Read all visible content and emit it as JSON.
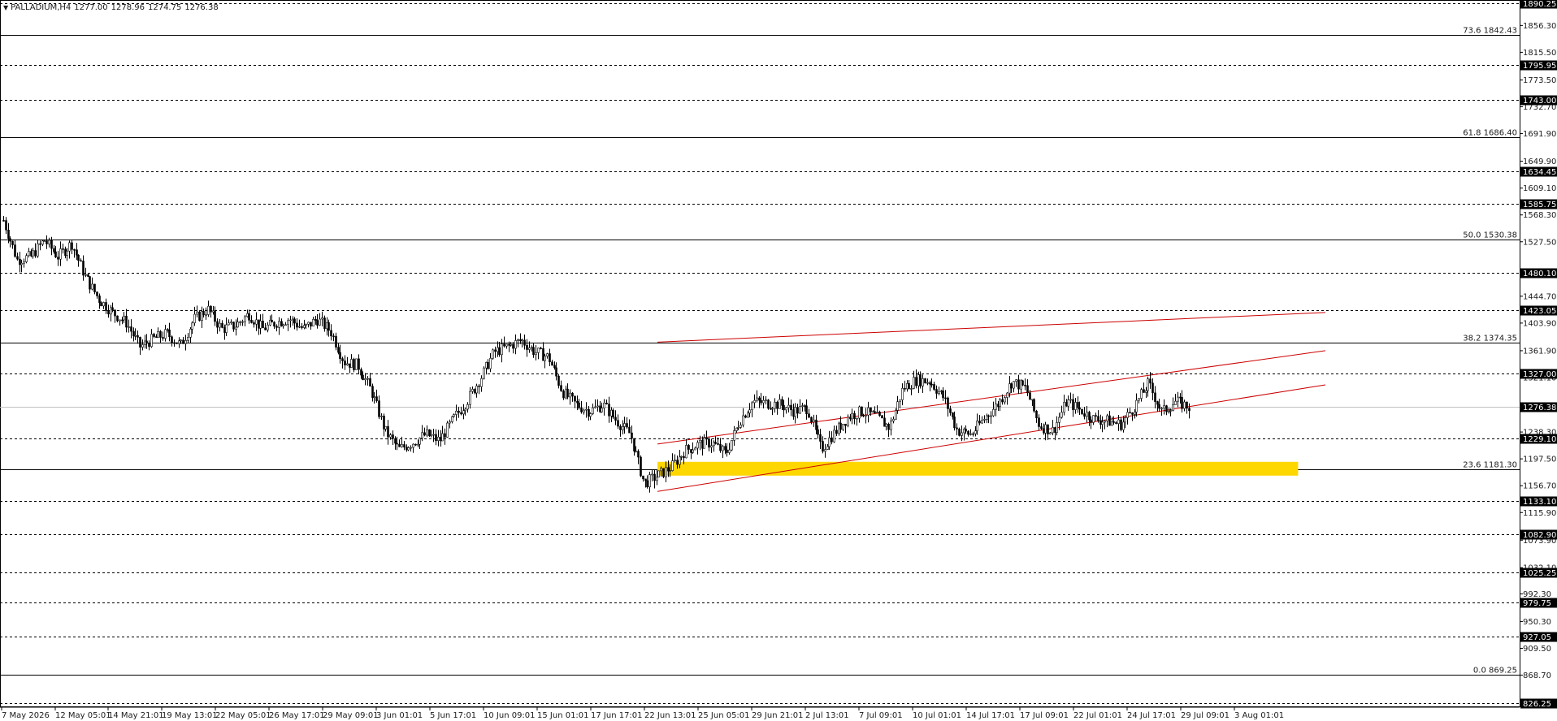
{
  "header": {
    "symbol": "PALLADIUM,H4",
    "open": "1277.00",
    "high": "1278.96",
    "low": "1274.75",
    "close": "1276.38"
  },
  "chart_data": {
    "type": "candlestick",
    "title": "PALLADIUM,H4",
    "y_range": [
      820,
      1895
    ],
    "price_ticks": [
      "1856.30",
      "1815.50",
      "1773.50",
      "1732.70",
      "1691.90",
      "1649.90",
      "1609.10",
      "1568.30",
      "1527.50",
      "1444.70",
      "1403.90",
      "1361.90",
      "1321.10",
      "1238.30",
      "1197.50",
      "1156.70",
      "1115.90",
      "1073.90",
      "1032.10",
      "992.30",
      "950.30",
      "909.50",
      "868.70"
    ],
    "horizontal_levels": [
      {
        "price": 1890.25,
        "style": "dashed",
        "boxed": true,
        "label": "1890.25"
      },
      {
        "price": 1795.95,
        "style": "dashed",
        "boxed": true,
        "label": "1795.95"
      },
      {
        "price": 1743.0,
        "style": "dashed",
        "boxed": true,
        "label": "1743.00"
      },
      {
        "price": 1634.45,
        "style": "dashed",
        "boxed": true,
        "label": "1634.45"
      },
      {
        "price": 1585.75,
        "style": "dashed",
        "boxed": true,
        "label": "1585.75"
      },
      {
        "price": 1480.1,
        "style": "dashed",
        "boxed": true,
        "label": "1480.10"
      },
      {
        "price": 1423.05,
        "style": "dashed",
        "boxed": true,
        "label": "1423.05"
      },
      {
        "price": 1327.0,
        "style": "dashed",
        "boxed": true,
        "label": "1327.00"
      },
      {
        "price": 1229.1,
        "style": "dashed",
        "boxed": true,
        "label": "1229.10"
      },
      {
        "price": 1133.1,
        "style": "dashed",
        "boxed": true,
        "label": "1133.10"
      },
      {
        "price": 1082.9,
        "style": "dashed",
        "boxed": true,
        "label": "1082.90"
      },
      {
        "price": 1025.25,
        "style": "dashed",
        "boxed": true,
        "label": "1025.25"
      },
      {
        "price": 979.75,
        "style": "dashed",
        "boxed": true,
        "label": "979.75"
      },
      {
        "price": 927.05,
        "style": "dashed",
        "boxed": true,
        "label": "927.05"
      },
      {
        "price": 826.25,
        "style": "dashed",
        "boxed": true,
        "label": "826.25"
      }
    ],
    "current_price": {
      "price": 1276.38,
      "label": "1276.38"
    },
    "fibonacci": [
      {
        "price": 1842.43,
        "label": "73.6 1842.43"
      },
      {
        "price": 1686.4,
        "label": "61.8 1686.40"
      },
      {
        "price": 1530.38,
        "label": "50.0 1530.38"
      },
      {
        "price": 1374.35,
        "label": "38.2 1374.35"
      },
      {
        "price": 1181.3,
        "label": "23.6 1181.30"
      },
      {
        "price": 869.25,
        "label": "0.0 869.25"
      }
    ],
    "support_zone": {
      "price_low": 1172,
      "price_high": 1193,
      "start_date": "24 Jun 2026",
      "end_date": "10 Aug 2026",
      "color": "#ffd700"
    },
    "channel_lines": [
      {
        "start_date": "24 Jun 2026",
        "start_price": 1375,
        "end_date": "12 Aug 2026",
        "end_price": 1420
      },
      {
        "start_date": "24 Jun 2026",
        "start_price": 1220,
        "end_date": "12 Aug 2026",
        "end_price": 1362
      },
      {
        "start_date": "24 Jun 2026",
        "start_price": 1148,
        "end_date": "12 Aug 2026",
        "end_price": 1310
      }
    ],
    "time_labels": [
      "7 May 2026",
      "12 May 05:01",
      "14 May 21:01",
      "19 May 13:01",
      "22 May 05:01",
      "26 May 17:01",
      "29 May 09:01",
      "3 Jun 01:01",
      "5 Jun 17:01",
      "10 Jun 09:01",
      "15 Jun 01:01",
      "17 Jun 17:01",
      "22 Jun 13:01",
      "25 Jun 05:01",
      "29 Jun 21:01",
      "2 Jul 13:01",
      "7 Jul 09:01",
      "10 Jul 01:01",
      "14 Jul 17:01",
      "17 Jul 09:01",
      "22 Jul 01:01",
      "24 Jul 17:01",
      "29 Jul 09:01",
      "3 Aug 01:01"
    ],
    "price_path": [
      [
        "7 May 2026",
        1560
      ],
      [
        "8 May 2026",
        1500
      ],
      [
        "9 May 2026",
        1505
      ],
      [
        "10 May 2026",
        1530
      ],
      [
        "11 May 2026",
        1505
      ],
      [
        "12 May 2026",
        1525
      ],
      [
        "13 May 2026",
        1475
      ],
      [
        "14 May 2026",
        1440
      ],
      [
        "15 May 2026",
        1420
      ],
      [
        "16 May 2026",
        1405
      ],
      [
        "17 May 2026",
        1368
      ],
      [
        "18 May 2026",
        1380
      ],
      [
        "19 May 2026",
        1388
      ],
      [
        "20 May 2026",
        1370
      ],
      [
        "21 May 2026",
        1410
      ],
      [
        "22 May 2026",
        1425
      ],
      [
        "23 May 2026",
        1395
      ],
      [
        "24 May 2026",
        1400
      ],
      [
        "25 May 2026",
        1418
      ],
      [
        "26 May 2026",
        1395
      ],
      [
        "27 May 2026",
        1405
      ],
      [
        "28 May 2026",
        1410
      ],
      [
        "29 May 2026",
        1395
      ],
      [
        "30 May 2026",
        1410
      ],
      [
        "31 May 2026",
        1392
      ],
      [
        "1 Jun 2026",
        1345
      ],
      [
        "2 Jun 2026",
        1340
      ],
      [
        "3 Jun 2026",
        1300
      ],
      [
        "4 Jun 2026",
        1240
      ],
      [
        "5 Jun 2026",
        1212
      ],
      [
        "6 Jun 2026",
        1222
      ],
      [
        "7 Jun 2026",
        1235
      ],
      [
        "8 Jun 2026",
        1225
      ],
      [
        "9 Jun 2026",
        1258
      ],
      [
        "10 Jun 2026",
        1285
      ],
      [
        "11 Jun 2026",
        1320
      ],
      [
        "12 Jun 2026",
        1360
      ],
      [
        "13 Jun 2026",
        1368
      ],
      [
        "14 Jun 2026",
        1378
      ],
      [
        "15 Jun 2026",
        1360
      ],
      [
        "16 Jun 2026",
        1352
      ],
      [
        "17 Jun 2026",
        1300
      ],
      [
        "18 Jun 2026",
        1280
      ],
      [
        "19 Jun 2026",
        1270
      ],
      [
        "20 Jun 2026",
        1280
      ],
      [
        "21 Jun 2026",
        1255
      ],
      [
        "22 Jun 2026",
        1235
      ],
      [
        "23 Jun 2026",
        1160
      ],
      [
        "24 Jun 2026",
        1172
      ],
      [
        "25 Jun 2026",
        1185
      ],
      [
        "26 Jun 2026",
        1210
      ],
      [
        "27 Jun 2026",
        1220
      ],
      [
        "28 Jun 2026",
        1222
      ],
      [
        "29 Jun 2026",
        1205
      ],
      [
        "30 Jun 2026",
        1255
      ],
      [
        "1 Jul 2026",
        1285
      ],
      [
        "2 Jul 2026",
        1282
      ],
      [
        "3 Jul 2026",
        1280
      ],
      [
        "4 Jul 2026",
        1270
      ],
      [
        "5 Jul 2026",
        1275
      ],
      [
        "6 Jul 2026",
        1212
      ],
      [
        "7 Jul 2026",
        1238
      ],
      [
        "8 Jul 2026",
        1262
      ],
      [
        "9 Jul 2026",
        1270
      ],
      [
        "10 Jul 2026",
        1262
      ],
      [
        "11 Jul 2026",
        1245
      ],
      [
        "12 Jul 2026",
        1305
      ],
      [
        "13 Jul 2026",
        1318
      ],
      [
        "14 Jul 2026",
        1315
      ],
      [
        "15 Jul 2026",
        1290
      ],
      [
        "16 Jul 2026",
        1240
      ],
      [
        "17 Jul 2026",
        1235
      ],
      [
        "18 Jul 2026",
        1260
      ],
      [
        "19 Jul 2026",
        1282
      ],
      [
        "20 Jul 2026",
        1315
      ],
      [
        "21 Jul 2026",
        1305
      ],
      [
        "22 Jul 2026",
        1248
      ],
      [
        "23 Jul 2026",
        1240
      ],
      [
        "24 Jul 2026",
        1285
      ],
      [
        "25 Jul 2026",
        1272
      ],
      [
        "26 Jul 2026",
        1258
      ],
      [
        "27 Jul 2026",
        1255
      ],
      [
        "28 Jul 2026",
        1250
      ],
      [
        "29 Jul 2026",
        1278
      ],
      [
        "30 Jul 2026",
        1312
      ],
      [
        "31 Jul 2026",
        1268
      ],
      [
        "1 Aug 2026",
        1285
      ],
      [
        "2 Aug 2026",
        1276
      ]
    ]
  }
}
